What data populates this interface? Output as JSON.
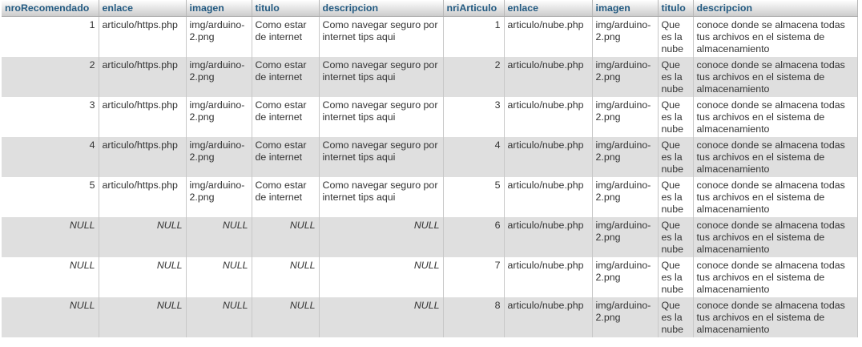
{
  "columns": [
    "nroRecomendado",
    "enlace",
    "imagen",
    "titulo",
    "descripcion",
    "nriArticulo",
    "enlace",
    "imagen",
    "titulo",
    "descripcion"
  ],
  "null_label": "NULL",
  "rows": [
    {
      "nroRecomendado": "1",
      "enlace1": "articulo/https.php",
      "imagen1": "img/arduino-2.png",
      "titulo1": "Como estar de internet",
      "descripcion1": "Como navegar seguro por internet tips aqui",
      "nriArticulo": "1",
      "enlace2": "articulo/nube.php",
      "imagen2": "img/arduino-2.png",
      "titulo2": "Que es la nube",
      "descripcion2": "conoce donde se almacena todas tus archivos en el sistema de almacenamiento"
    },
    {
      "nroRecomendado": "2",
      "enlace1": "articulo/https.php",
      "imagen1": "img/arduino-2.png",
      "titulo1": "Como estar de internet",
      "descripcion1": "Como navegar seguro por internet tips aqui",
      "nriArticulo": "2",
      "enlace2": "articulo/nube.php",
      "imagen2": "img/arduino-2.png",
      "titulo2": "Que es la nube",
      "descripcion2": "conoce donde se almacena todas tus archivos en el sistema de almacenamiento"
    },
    {
      "nroRecomendado": "3",
      "enlace1": "articulo/https.php",
      "imagen1": "img/arduino-2.png",
      "titulo1": "Como estar de internet",
      "descripcion1": "Como navegar seguro por internet tips aqui",
      "nriArticulo": "3",
      "enlace2": "articulo/nube.php",
      "imagen2": "img/arduino-2.png",
      "titulo2": "Que es la nube",
      "descripcion2": "conoce donde se almacena todas tus archivos en el sistema de almacenamiento"
    },
    {
      "nroRecomendado": "4",
      "enlace1": "articulo/https.php",
      "imagen1": "img/arduino-2.png",
      "titulo1": "Como estar de internet",
      "descripcion1": "Como navegar seguro por internet tips aqui",
      "nriArticulo": "4",
      "enlace2": "articulo/nube.php",
      "imagen2": "img/arduino-2.png",
      "titulo2": "Que es la nube",
      "descripcion2": "conoce donde se almacena todas tus archivos en el sistema de almacenamiento"
    },
    {
      "nroRecomendado": "5",
      "enlace1": "articulo/https.php",
      "imagen1": "img/arduino-2.png",
      "titulo1": "Como estar de internet",
      "descripcion1": "Como navegar seguro por internet tips aqui",
      "nriArticulo": "5",
      "enlace2": "articulo/nube.php",
      "imagen2": "img/arduino-2.png",
      "titulo2": "Que es la nube",
      "descripcion2": "conoce donde se almacena todas tus archivos en el sistema de almacenamiento"
    },
    {
      "nroRecomendado": null,
      "enlace1": null,
      "imagen1": null,
      "titulo1": null,
      "descripcion1": null,
      "nriArticulo": "6",
      "enlace2": "articulo/nube.php",
      "imagen2": "img/arduino-2.png",
      "titulo2": "Que es la nube",
      "descripcion2": "conoce donde se almacena todas tus archivos en el sistema de almacenamiento"
    },
    {
      "nroRecomendado": null,
      "enlace1": null,
      "imagen1": null,
      "titulo1": null,
      "descripcion1": null,
      "nriArticulo": "7",
      "enlace2": "articulo/nube.php",
      "imagen2": "img/arduino-2.png",
      "titulo2": "Que es la nube",
      "descripcion2": "conoce donde se almacena todas tus archivos en el sistema de almacenamiento"
    },
    {
      "nroRecomendado": null,
      "enlace1": null,
      "imagen1": null,
      "titulo1": null,
      "descripcion1": null,
      "nriArticulo": "8",
      "enlace2": "articulo/nube.php",
      "imagen2": "img/arduino-2.png",
      "titulo2": "Que es la nube",
      "descripcion2": "conoce donde se almacena todas tus archivos en el sistema de almacenamiento"
    }
  ]
}
